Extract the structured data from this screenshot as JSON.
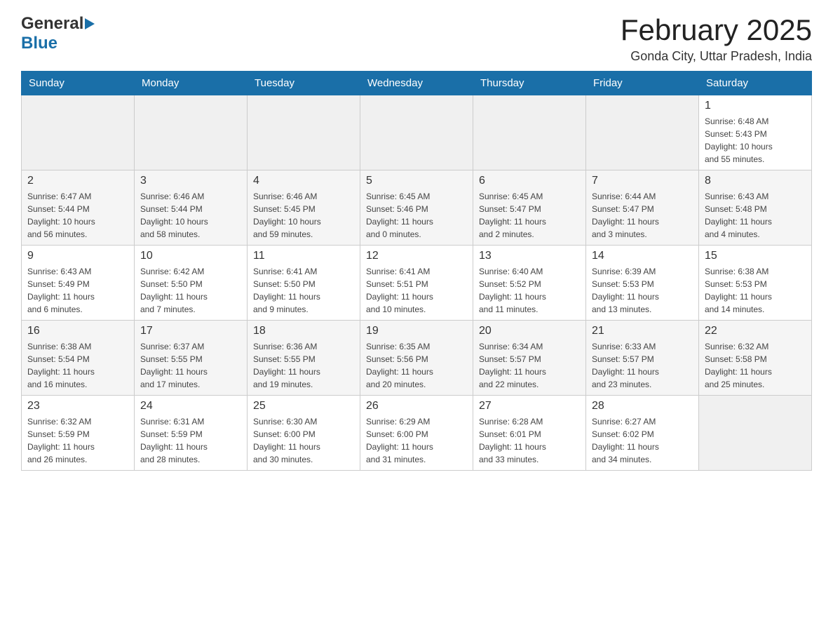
{
  "header": {
    "title": "February 2025",
    "location": "Gonda City, Uttar Pradesh, India",
    "logo_general": "General",
    "logo_blue": "Blue"
  },
  "weekdays": [
    "Sunday",
    "Monday",
    "Tuesday",
    "Wednesday",
    "Thursday",
    "Friday",
    "Saturday"
  ],
  "weeks": [
    [
      {
        "day": "",
        "info": ""
      },
      {
        "day": "",
        "info": ""
      },
      {
        "day": "",
        "info": ""
      },
      {
        "day": "",
        "info": ""
      },
      {
        "day": "",
        "info": ""
      },
      {
        "day": "",
        "info": ""
      },
      {
        "day": "1",
        "info": "Sunrise: 6:48 AM\nSunset: 5:43 PM\nDaylight: 10 hours\nand 55 minutes."
      }
    ],
    [
      {
        "day": "2",
        "info": "Sunrise: 6:47 AM\nSunset: 5:44 PM\nDaylight: 10 hours\nand 56 minutes."
      },
      {
        "day": "3",
        "info": "Sunrise: 6:46 AM\nSunset: 5:44 PM\nDaylight: 10 hours\nand 58 minutes."
      },
      {
        "day": "4",
        "info": "Sunrise: 6:46 AM\nSunset: 5:45 PM\nDaylight: 10 hours\nand 59 minutes."
      },
      {
        "day": "5",
        "info": "Sunrise: 6:45 AM\nSunset: 5:46 PM\nDaylight: 11 hours\nand 0 minutes."
      },
      {
        "day": "6",
        "info": "Sunrise: 6:45 AM\nSunset: 5:47 PM\nDaylight: 11 hours\nand 2 minutes."
      },
      {
        "day": "7",
        "info": "Sunrise: 6:44 AM\nSunset: 5:47 PM\nDaylight: 11 hours\nand 3 minutes."
      },
      {
        "day": "8",
        "info": "Sunrise: 6:43 AM\nSunset: 5:48 PM\nDaylight: 11 hours\nand 4 minutes."
      }
    ],
    [
      {
        "day": "9",
        "info": "Sunrise: 6:43 AM\nSunset: 5:49 PM\nDaylight: 11 hours\nand 6 minutes."
      },
      {
        "day": "10",
        "info": "Sunrise: 6:42 AM\nSunset: 5:50 PM\nDaylight: 11 hours\nand 7 minutes."
      },
      {
        "day": "11",
        "info": "Sunrise: 6:41 AM\nSunset: 5:50 PM\nDaylight: 11 hours\nand 9 minutes."
      },
      {
        "day": "12",
        "info": "Sunrise: 6:41 AM\nSunset: 5:51 PM\nDaylight: 11 hours\nand 10 minutes."
      },
      {
        "day": "13",
        "info": "Sunrise: 6:40 AM\nSunset: 5:52 PM\nDaylight: 11 hours\nand 11 minutes."
      },
      {
        "day": "14",
        "info": "Sunrise: 6:39 AM\nSunset: 5:53 PM\nDaylight: 11 hours\nand 13 minutes."
      },
      {
        "day": "15",
        "info": "Sunrise: 6:38 AM\nSunset: 5:53 PM\nDaylight: 11 hours\nand 14 minutes."
      }
    ],
    [
      {
        "day": "16",
        "info": "Sunrise: 6:38 AM\nSunset: 5:54 PM\nDaylight: 11 hours\nand 16 minutes."
      },
      {
        "day": "17",
        "info": "Sunrise: 6:37 AM\nSunset: 5:55 PM\nDaylight: 11 hours\nand 17 minutes."
      },
      {
        "day": "18",
        "info": "Sunrise: 6:36 AM\nSunset: 5:55 PM\nDaylight: 11 hours\nand 19 minutes."
      },
      {
        "day": "19",
        "info": "Sunrise: 6:35 AM\nSunset: 5:56 PM\nDaylight: 11 hours\nand 20 minutes."
      },
      {
        "day": "20",
        "info": "Sunrise: 6:34 AM\nSunset: 5:57 PM\nDaylight: 11 hours\nand 22 minutes."
      },
      {
        "day": "21",
        "info": "Sunrise: 6:33 AM\nSunset: 5:57 PM\nDaylight: 11 hours\nand 23 minutes."
      },
      {
        "day": "22",
        "info": "Sunrise: 6:32 AM\nSunset: 5:58 PM\nDaylight: 11 hours\nand 25 minutes."
      }
    ],
    [
      {
        "day": "23",
        "info": "Sunrise: 6:32 AM\nSunset: 5:59 PM\nDaylight: 11 hours\nand 26 minutes."
      },
      {
        "day": "24",
        "info": "Sunrise: 6:31 AM\nSunset: 5:59 PM\nDaylight: 11 hours\nand 28 minutes."
      },
      {
        "day": "25",
        "info": "Sunrise: 6:30 AM\nSunset: 6:00 PM\nDaylight: 11 hours\nand 30 minutes."
      },
      {
        "day": "26",
        "info": "Sunrise: 6:29 AM\nSunset: 6:00 PM\nDaylight: 11 hours\nand 31 minutes."
      },
      {
        "day": "27",
        "info": "Sunrise: 6:28 AM\nSunset: 6:01 PM\nDaylight: 11 hours\nand 33 minutes."
      },
      {
        "day": "28",
        "info": "Sunrise: 6:27 AM\nSunset: 6:02 PM\nDaylight: 11 hours\nand 34 minutes."
      },
      {
        "day": "",
        "info": ""
      }
    ]
  ]
}
